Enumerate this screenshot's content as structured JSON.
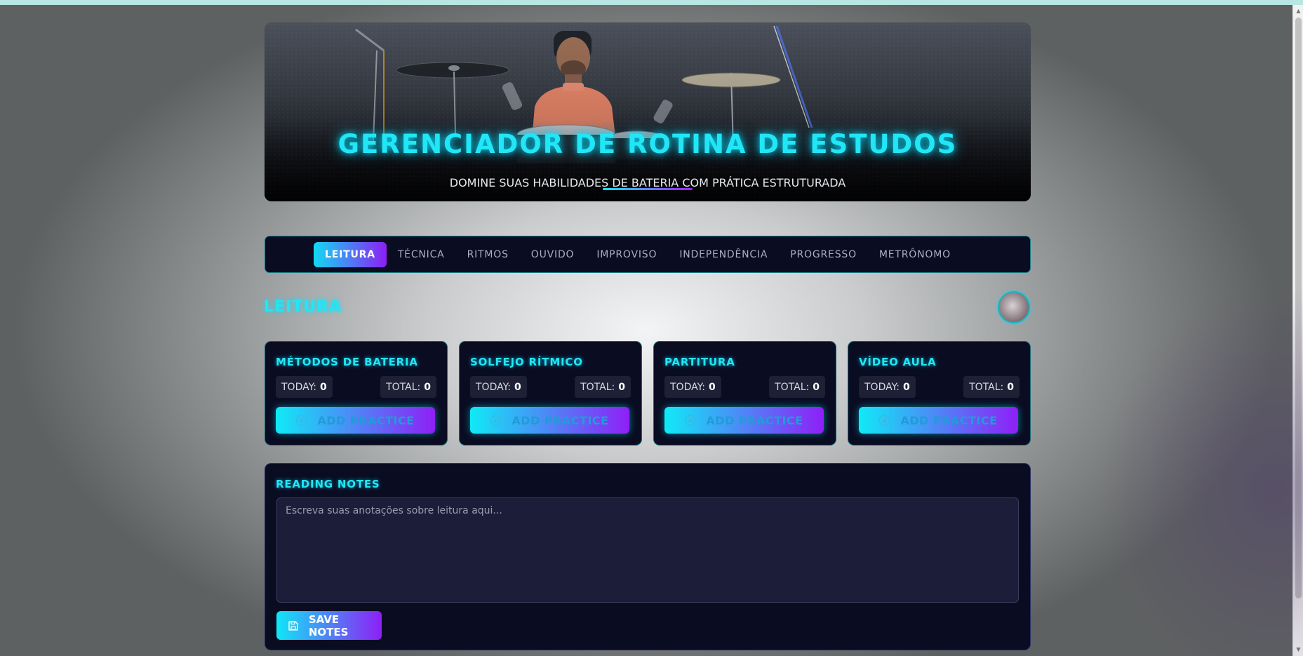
{
  "hero": {
    "title": "GERENCIADOR DE ROTINA DE ESTUDOS",
    "subtitle": "DOMINE SUAS HABILIDADES DE BATERIA COM PRÁTICA ESTRUTURADA"
  },
  "tabs": [
    {
      "label": "LEITURA",
      "active": true
    },
    {
      "label": "TÉCNICA",
      "active": false
    },
    {
      "label": "RITMOS",
      "active": false
    },
    {
      "label": "OUVIDO",
      "active": false
    },
    {
      "label": "IMPROVISO",
      "active": false
    },
    {
      "label": "INDEPENDÊNCIA",
      "active": false
    },
    {
      "label": "PROGRESSO",
      "active": false
    },
    {
      "label": "METRÔNOMO",
      "active": false
    }
  ],
  "section": {
    "title": "LEITURA"
  },
  "cards": [
    {
      "title": "MÉTODOS DE BATERIA",
      "today_label": "TODAY:",
      "today": "0",
      "total_label": "TOTAL:",
      "total": "0",
      "button": "ADD PRACTICE"
    },
    {
      "title": "SOLFEJO RÍTMICO",
      "today_label": "TODAY:",
      "today": "0",
      "total_label": "TOTAL:",
      "total": "0",
      "button": "ADD PRACTICE"
    },
    {
      "title": "PARTITURA",
      "today_label": "TODAY:",
      "today": "0",
      "total_label": "TOTAL:",
      "total": "0",
      "button": "ADD PRACTICE"
    },
    {
      "title": "VÍDEO AULA",
      "today_label": "TODAY:",
      "today": "0",
      "total_label": "TOTAL:",
      "total": "0",
      "button": "ADD PRACTICE"
    }
  ],
  "notes": {
    "title": "READING NOTES",
    "placeholder": "Escreva suas anotações sobre leitura aqui...",
    "value": "",
    "save_label": "SAVE NOTES"
  },
  "colors": {
    "accent": "#22e6f5",
    "gradient_start": "#10e6f6",
    "gradient_end": "#8f1ff6",
    "panel": "#0a0c22"
  },
  "icons": {
    "add": "plus-circle-icon",
    "save": "save-floppy-icon",
    "avatar": "drummer-avatar"
  }
}
